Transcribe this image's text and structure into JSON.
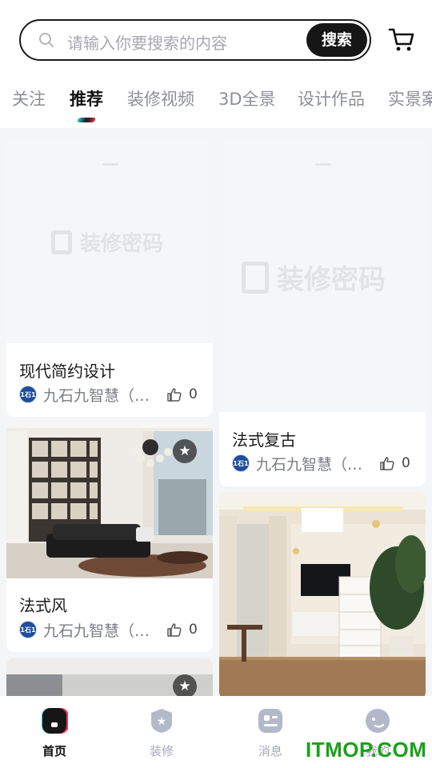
{
  "search": {
    "placeholder": "请输入你要搜索的内容",
    "button_label": "搜索"
  },
  "tabs": [
    {
      "label": "关注",
      "active": false
    },
    {
      "label": "推荐",
      "active": true
    },
    {
      "label": "装修视频",
      "active": false
    },
    {
      "label": "3D全景",
      "active": false
    },
    {
      "label": "设计作品",
      "active": false
    },
    {
      "label": "实景案",
      "active": false
    }
  ],
  "placeholder_brand": "装修密码",
  "cards": [
    {
      "title": "现代简约设计",
      "author": "九石九智慧（天津）",
      "likes": "0",
      "avatar_text": "1石1",
      "image": "placeholder"
    },
    {
      "title": "法式复古",
      "author": "九石九智慧（天津）",
      "likes": "0",
      "avatar_text": "1石1",
      "image": "placeholder"
    },
    {
      "title": "法式风",
      "author": "九石九智慧（天津）",
      "likes": "0",
      "avatar_text": "1石1",
      "image": "living-room-photo"
    },
    {
      "title": "",
      "author": "",
      "likes": "",
      "avatar_text": "",
      "image": "living-room-photo-2"
    },
    {
      "title": "",
      "author": "",
      "likes": "",
      "avatar_text": "",
      "image": "partial-photo"
    }
  ],
  "nav": {
    "items": [
      {
        "label": "首页",
        "icon": "home-icon",
        "active": true
      },
      {
        "label": "装修",
        "icon": "renovation-icon",
        "active": false
      },
      {
        "label": "消息",
        "icon": "message-icon",
        "active": false
      },
      {
        "label": "我的",
        "icon": "profile-icon",
        "active": false
      }
    ]
  },
  "watermark": "ITMOP.COM",
  "colors": {
    "accent_cyan": "#23d2e0",
    "accent_red": "#ee3356",
    "watermark_green": "#1ba11b",
    "text_dark": "#111111",
    "text_muted": "#8d8f96"
  }
}
